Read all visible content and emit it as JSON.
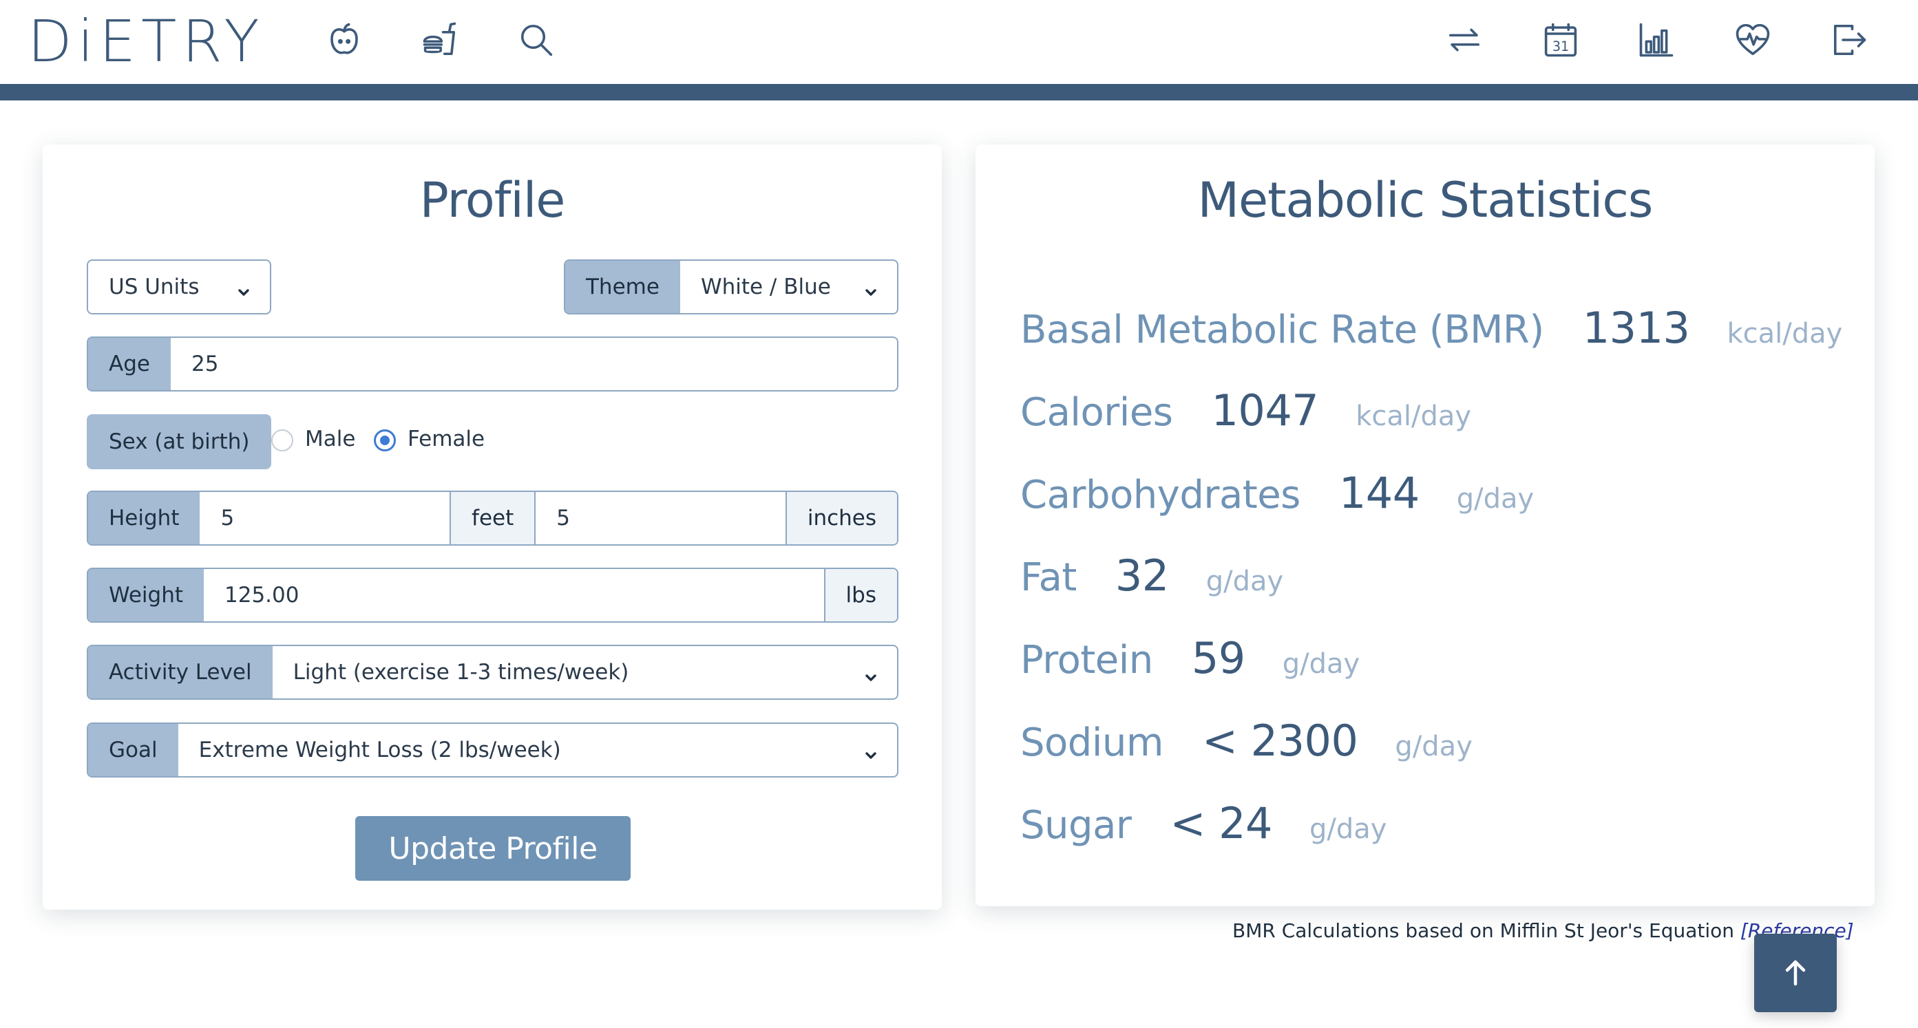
{
  "app": {
    "logo": "DiETRY"
  },
  "nav": {
    "left_icons": [
      "apple-icon",
      "burger-drink-icon",
      "search-icon"
    ],
    "right_icons": [
      "swap-icon",
      "calendar-icon",
      "bar-chart-icon",
      "heart-pulse-icon",
      "logout-icon"
    ],
    "calendar_day": "31"
  },
  "colors": {
    "primary": "#3d5a7a",
    "label_bg": "#a4bbd3",
    "button": "#6f93b5",
    "radio_accent": "#3f7bd4"
  },
  "profile": {
    "title": "Profile",
    "units": {
      "value": "US Units"
    },
    "theme": {
      "label": "Theme",
      "value": "White / Blue"
    },
    "age": {
      "label": "Age",
      "value": "25"
    },
    "sex": {
      "label": "Sex (at birth)",
      "options": [
        "Male",
        "Female"
      ],
      "selected": "Female"
    },
    "height": {
      "label": "Height",
      "feet_value": "5",
      "feet_unit": "feet",
      "inches_value": "5",
      "inches_unit": "inches"
    },
    "weight": {
      "label": "Weight",
      "value": "125.00",
      "unit": "lbs"
    },
    "activity": {
      "label": "Activity Level",
      "value": "Light (exercise 1-3 times/week)"
    },
    "goal": {
      "label": "Goal",
      "value": "Extreme Weight Loss (2 lbs/week)"
    },
    "update_button": "Update Profile"
  },
  "stats": {
    "title": "Metabolic Statistics",
    "rows": [
      {
        "name": "Basal Metabolic Rate (BMR)",
        "value": "1313",
        "unit": "kcal/day"
      },
      {
        "name": "Calories",
        "value": "1047",
        "unit": "kcal/day"
      },
      {
        "name": "Carbohydrates",
        "value": "144",
        "unit": "g/day"
      },
      {
        "name": "Fat",
        "value": "32",
        "unit": "g/day"
      },
      {
        "name": "Protein",
        "value": "59",
        "unit": "g/day"
      },
      {
        "name": "Sodium",
        "value": "< 2300",
        "unit": "g/day"
      },
      {
        "name": "Sugar",
        "value": "< 24",
        "unit": "g/day"
      }
    ],
    "footnote": "BMR Calculations based on Mifflin St Jeor's Equation",
    "footnote_link": "[Reference]"
  }
}
